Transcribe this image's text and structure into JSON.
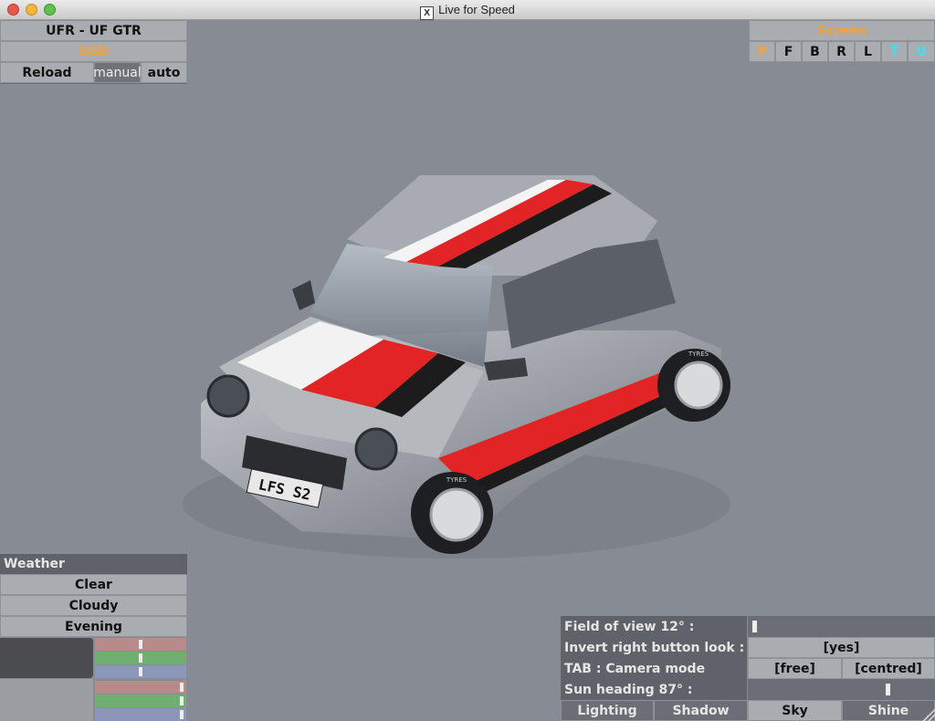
{
  "window": {
    "title": "Live for Speed"
  },
  "car_panel": {
    "car_name": "UFR - UF GTR",
    "skin": "SGD",
    "reload_label": "Reload",
    "manual_label": "manual",
    "auto_label": "auto"
  },
  "screen_panel": {
    "title": "Screen",
    "buttons": [
      "P",
      "F",
      "B",
      "R",
      "L",
      "T",
      "U"
    ]
  },
  "car": {
    "plate": "LFS S2",
    "tyre_text": "TYRES"
  },
  "weather": {
    "title": "Weather",
    "options": [
      "Clear",
      "Cloudy",
      "Evening"
    ]
  },
  "view_settings": {
    "fov_label": "Field of view 12° :",
    "invert_label": "Invert right button look :",
    "invert_value": "[yes]",
    "tab_label": "TAB : Camera mode",
    "mode_free": "[free]",
    "mode_centred": "[centred]",
    "sun_label": "Sun heading 87° :",
    "fov_degrees": 12,
    "sun_heading_degrees": 87,
    "tabs": [
      "Lighting",
      "Shadow",
      "Sky",
      "Shine"
    ]
  },
  "colors": {
    "accent_orange": "#f2a23a",
    "accent_cyan": "#34e6ef",
    "background": "#878c94"
  }
}
